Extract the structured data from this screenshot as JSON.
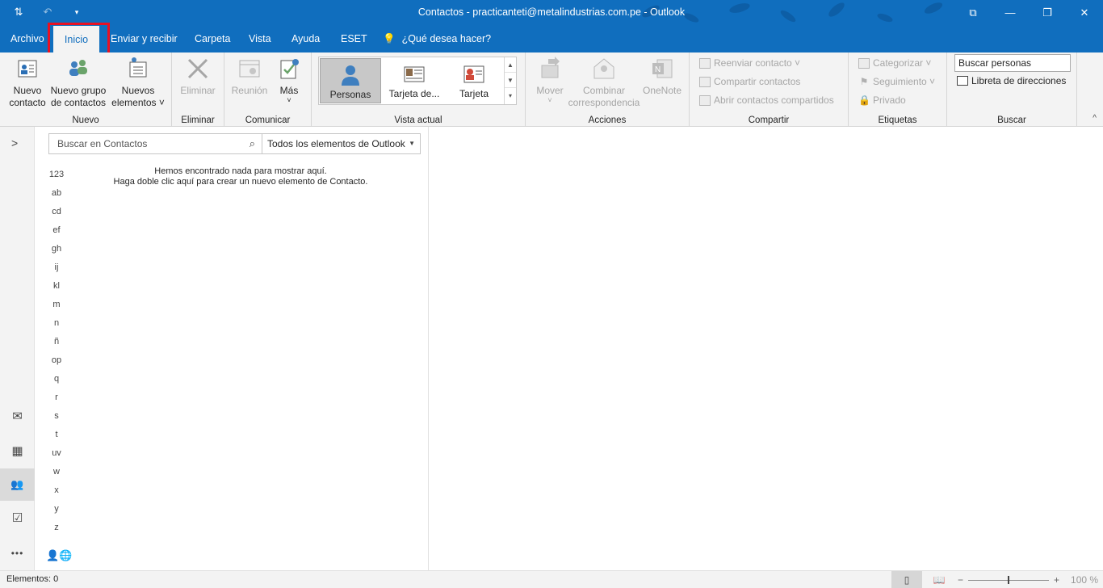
{
  "window": {
    "title": "Contactos - practicanteti@metalindustrias.com.pe  -  Outlook",
    "qat": {
      "send_receive_icon": "send-receive-all-icon",
      "undo_icon": "undo-icon",
      "customize_icon": "qat-customize-icon"
    },
    "controls": {
      "restore_ribbon": "ribbon-display-icon",
      "minimize": "—",
      "maximize": "❐",
      "close": "✕"
    }
  },
  "tabs": [
    {
      "id": "archivo",
      "label": "Archivo"
    },
    {
      "id": "inicio",
      "label": "Inicio",
      "active": true
    },
    {
      "id": "enviar",
      "label": "Enviar y recibir"
    },
    {
      "id": "carpeta",
      "label": "Carpeta"
    },
    {
      "id": "vista",
      "label": "Vista"
    },
    {
      "id": "ayuda",
      "label": "Ayuda"
    },
    {
      "id": "eset",
      "label": "ESET"
    },
    {
      "id": "tell",
      "label": "¿Qué desea hacer?"
    }
  ],
  "ribbon": {
    "nuevo": {
      "label": "Nuevo",
      "nuevo_contacto": [
        "Nuevo",
        "contacto"
      ],
      "nuevo_grupo": [
        "Nuevo grupo",
        "de contactos"
      ],
      "nuevos_elementos": [
        "Nuevos",
        "elementos ˅"
      ]
    },
    "eliminar": {
      "label": "Eliminar",
      "btn": "Eliminar"
    },
    "comunicar": {
      "label": "Comunicar",
      "reunion": "Reunión",
      "mas": "Más",
      "mas_caret": "˅"
    },
    "vista_actual": {
      "label": "Vista actual",
      "items": [
        "Personas",
        "Tarjeta de...",
        "Tarjeta"
      ],
      "scroll": [
        "▲",
        "▼",
        "▾"
      ]
    },
    "acciones": {
      "label": "Acciones",
      "mover": "Mover",
      "mover_caret": "˅",
      "combinar": [
        "Combinar",
        "correspondencia"
      ],
      "onenote": "OneNote"
    },
    "compartir": {
      "label": "Compartir",
      "reenviar": "Reenviar contacto ˅",
      "compartir_contactos": "Compartir contactos",
      "abrir_compartidos": "Abrir contactos compartidos"
    },
    "etiquetas": {
      "label": "Etiquetas",
      "categorizar": "Categorizar ˅",
      "seguimiento": "Seguimiento ˅",
      "privado": "Privado"
    },
    "buscar": {
      "label": "Buscar",
      "buscar_personas": "Buscar personas",
      "libreta": "Libreta de direcciones"
    },
    "collapse": "^"
  },
  "navrail": {
    "expander": ">",
    "items": [
      {
        "name": "mail",
        "icon": "✉"
      },
      {
        "name": "calendar",
        "icon": "▦"
      },
      {
        "name": "people",
        "icon": "👥",
        "active": true
      },
      {
        "name": "tasks",
        "icon": "☑"
      },
      {
        "name": "more",
        "icon": "•••"
      }
    ]
  },
  "contacts": {
    "search_placeholder": "Buscar en Contactos",
    "search_icon": "⌕",
    "scope": "Todos los elementos de Outlook",
    "scope_caret": "▼",
    "alphabet": [
      "123",
      "ab",
      "cd",
      "ef",
      "gh",
      "ij",
      "kl",
      "m",
      "n",
      "ñ",
      "op",
      "q",
      "r",
      "s",
      "t",
      "uv",
      "w",
      "x",
      "y",
      "z"
    ],
    "empty_line1": "Hemos encontrado nada para mostrar aquí.",
    "empty_line2": "Haga doble clic aquí para crear un nuevo elemento de Contacto.",
    "address_icon": "👤🌐"
  },
  "status": {
    "count": "Elementos: 0",
    "zoom_minus": "−",
    "zoom_plus": "+",
    "zoom_pct": "100 %",
    "zoom_level": 1.0
  },
  "colors": {
    "accent": "#106ebe",
    "ribbon_bg": "#f3f3f3",
    "highlight": "#e81123"
  }
}
